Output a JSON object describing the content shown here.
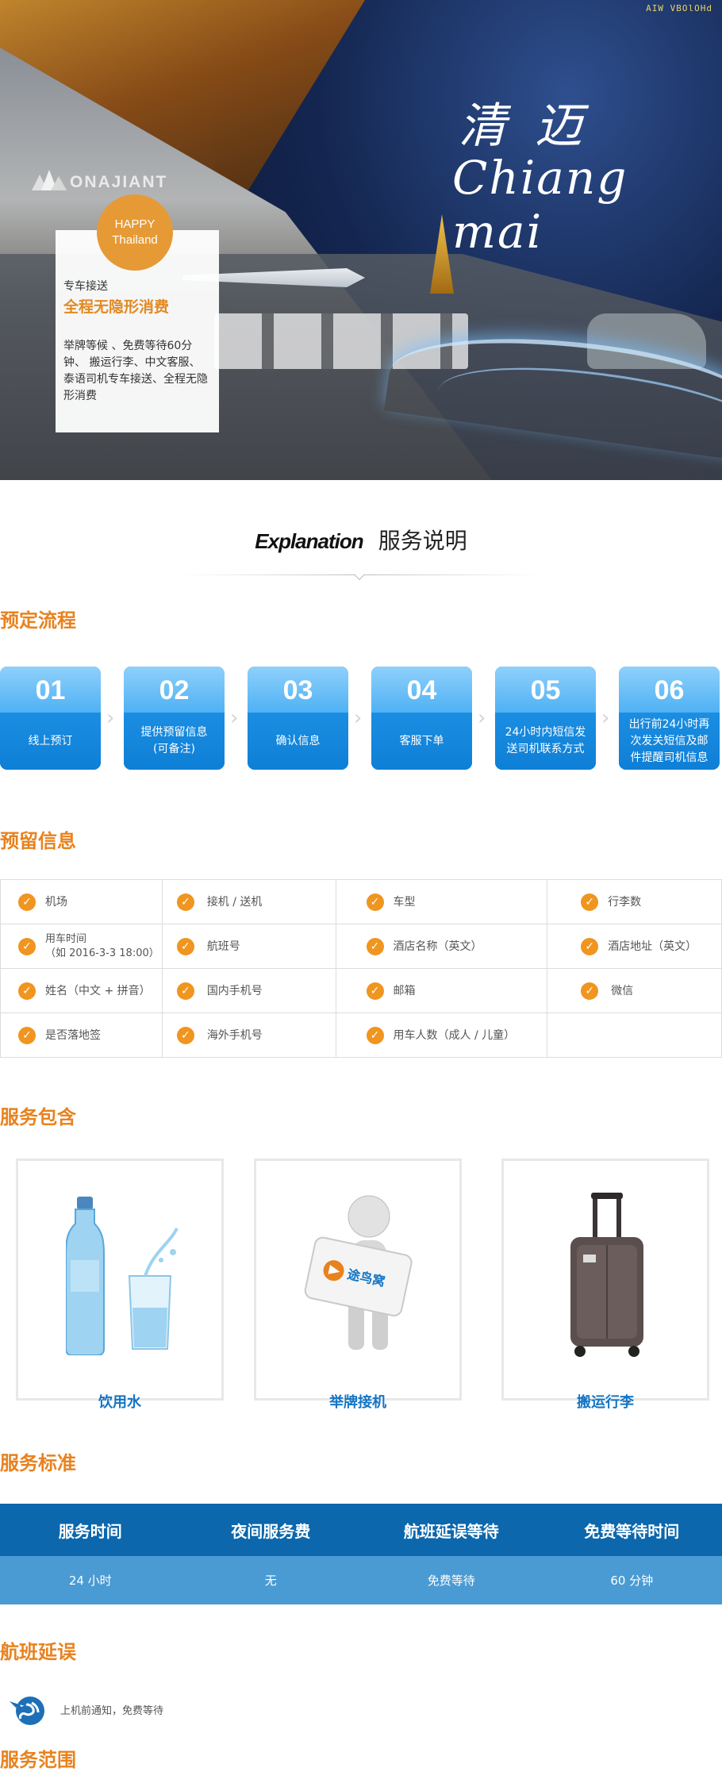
{
  "hero": {
    "top_right_logo": "AIW VBOlOHd",
    "left_logo": "ONAJIANT",
    "title_cn": "清迈",
    "title_en": "Chiang mai",
    "badge_line1": "HAPPY",
    "badge_line2": "Thailand",
    "card_sub": "专车接送",
    "card_heading": "全程无隐形消费",
    "card_body": "举牌等候 、免费等待60分钟、 搬运行李、中文客服、 泰语司机专车接送、全程无隐形消费"
  },
  "explanation": {
    "en": "Explanation",
    "cn": "服务说明"
  },
  "sections": {
    "booking_flow": "预定流程",
    "reserve_info": "预留信息",
    "service_included": "服务包含",
    "service_standard": "服务标准",
    "flight_delay": "航班延误",
    "service_scope": "服务范围"
  },
  "steps": [
    {
      "num": "01",
      "label": "线上预订"
    },
    {
      "num": "02",
      "label": "提供预留信息\n(可备注)"
    },
    {
      "num": "03",
      "label": "确认信息"
    },
    {
      "num": "04",
      "label": "客服下单"
    },
    {
      "num": "05",
      "label": "24小时内短信发送司机联系方式"
    },
    {
      "num": "06",
      "label": "出行前24小时再次发关短信及邮件提醒司机信息"
    }
  ],
  "info_rows": [
    [
      "机场",
      "接机 / 送机",
      "车型",
      "行李数"
    ],
    [
      "用车时间\n（如 2016-3-3 18:00）",
      "航班号",
      "酒店名称（英文）",
      "酒店地址（英文）"
    ],
    [
      "姓名（中文 + 拼音）",
      "国内手机号",
      "邮箱",
      "微信"
    ],
    [
      "是否落地签",
      "海外手机号",
      "用车人数（成人 / 儿童）",
      ""
    ]
  ],
  "services": [
    {
      "label": "饮用水",
      "icon": "water-bottle"
    },
    {
      "label": "举牌接机",
      "icon": "sign-holder",
      "sign_text": "途鸟窝"
    },
    {
      "label": "搬运行李",
      "icon": "luggage"
    }
  ],
  "standard": {
    "headers": [
      "服务时间",
      "夜间服务费",
      "航班延误等待",
      "免费等待时间"
    ],
    "values": [
      "24 小时",
      "无",
      "免费等待",
      "60 分钟"
    ]
  },
  "delay": {
    "text": "上机前通知，免费等待",
    "icon": "globe-plane-icon"
  },
  "colors": {
    "accent_orange": "#e8821e",
    "step_blue": "#1b8ee2",
    "table_head_blue": "#0c67ac",
    "table_body_blue": "#4a9bd3"
  }
}
